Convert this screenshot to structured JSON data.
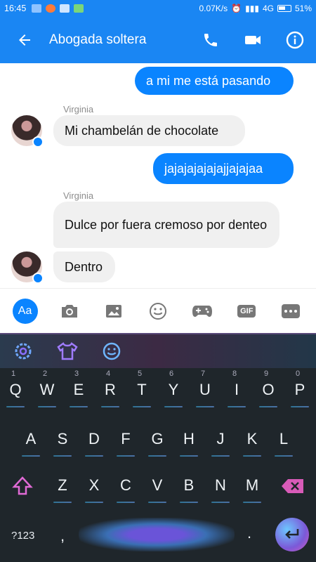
{
  "status_bar": {
    "time": "16:45",
    "speed": "0.07K/s",
    "network": "4G",
    "battery": "51%"
  },
  "header": {
    "title": "Abogada soltera",
    "back_icon": "arrow-left-icon",
    "call_icon": "phone-icon",
    "video_icon": "video-camera-icon",
    "info_icon": "info-icon"
  },
  "messages": [
    {
      "type": "outgoing",
      "text": "a mi me está pasando"
    },
    {
      "type": "sender",
      "text": "Virginia"
    },
    {
      "type": "incoming",
      "text": "Mi chambelán de chocolate"
    },
    {
      "type": "outgoing",
      "text": "jajajajajajajjajajaa"
    },
    {
      "type": "sender",
      "text": "Virginia"
    },
    {
      "type": "incoming",
      "text": "Dulce por fuera cremoso por denteo"
    },
    {
      "type": "incoming",
      "text": "Dentro"
    }
  ],
  "composer": {
    "aa_label": "Aa",
    "icons": [
      "camera-icon",
      "image-icon",
      "emoji-icon",
      "gamepad-icon",
      "gif-icon",
      "more-icon"
    ],
    "gif_label": "GIF"
  },
  "keyboard": {
    "toolbar_icons": [
      "gear-icon",
      "shirt-icon",
      "smiley-icon"
    ],
    "row1": [
      "Q",
      "W",
      "E",
      "R",
      "T",
      "Y",
      "U",
      "I",
      "O",
      "P"
    ],
    "row1_nums": [
      "1",
      "2",
      "3",
      "4",
      "5",
      "6",
      "7",
      "8",
      "9",
      "0"
    ],
    "row2": [
      "A",
      "S",
      "D",
      "F",
      "G",
      "H",
      "J",
      "K",
      "L"
    ],
    "row3": [
      "Z",
      "X",
      "C",
      "V",
      "B",
      "N",
      "M"
    ],
    "symbols_label": "?123",
    "comma": ",",
    "period": "."
  },
  "colors": {
    "brand": "#1a86f3",
    "outgoing_bubble": "#0a84ff",
    "incoming_bubble": "#f0f0f0",
    "keyboard_bg": "#1f262b"
  }
}
